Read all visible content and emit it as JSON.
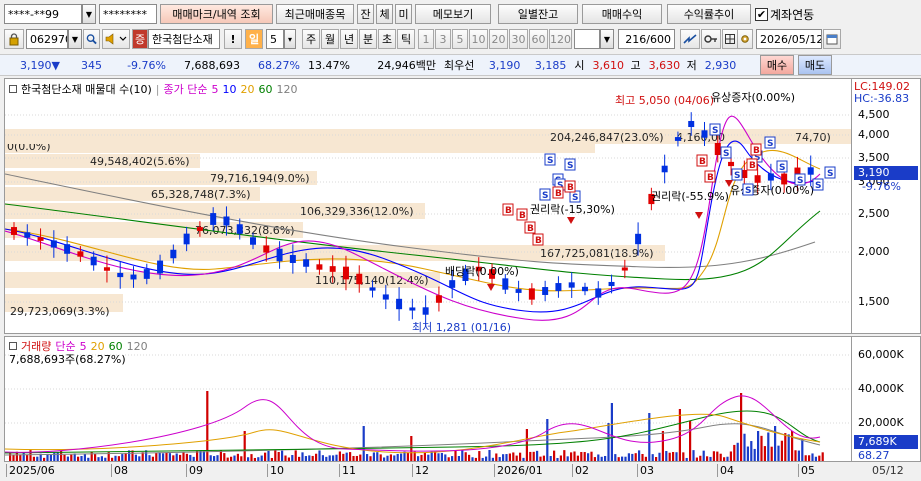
{
  "account": {
    "account_no": "****-**99",
    "password": "********",
    "tabs": [
      "매매마크/내역 조회",
      "최근매매종목",
      "잔",
      "체",
      "미",
      "메모보기"
    ],
    "right_buttons": [
      "일별잔고",
      "매매수익",
      "수익률추이"
    ],
    "link_label": "계좌연동",
    "link_checked": true
  },
  "toolbar": {
    "code": "062970",
    "name": "한국첨단소재",
    "period_selected": "일",
    "period_value": "5",
    "periods": [
      "주",
      "월",
      "년",
      "분",
      "초",
      "틱"
    ],
    "intervals": [
      "1",
      "3",
      "5",
      "10",
      "20",
      "30",
      "60",
      "120"
    ],
    "count": "216",
    "count_total": "/600",
    "date": "2026/05/12",
    "mark_icon": "exclamation-icon"
  },
  "quote": {
    "price": "3,190",
    "change": "345",
    "rate": "-9.76%",
    "volume": "7,688,693",
    "vol_ratio": "68.27%",
    "turnover": "13.47%",
    "amount": "24,946백만",
    "best_bid_label": "최우선",
    "best_ask": "3,190",
    "best_bid": "3,185",
    "open_label": "시",
    "open": "3,610",
    "high_label": "고",
    "high": "3,630",
    "low_label": "저",
    "low": "2,930",
    "buy_label": "매수",
    "sell_label": "매도"
  },
  "price_chart": {
    "title": "한국첨단소재 매물대 수(10)",
    "ma_label": "종가 단순",
    "ma_periods": [
      "5",
      "10",
      "20",
      "60",
      "120"
    ],
    "ma_colors": [
      "#cc00cc",
      "#0000ff",
      "#e0a000",
      "#008000",
      "#808080"
    ],
    "lc": "LC:149.02",
    "hc": "HC:-36.83",
    "current_price": "3,190",
    "current_rate": "-9.76%",
    "high_note": "최고 5,050 (04/06)",
    "low_note": "최저 1,281 (01/16)",
    "annotations": [
      "유상증자(0.00%)",
      "권리락(-15,30%)",
      "권리락(-55.9%)",
      "유상증자(0.00%)",
      "배당락(0.00%)"
    ],
    "volume_profile": [
      {
        "label": "0(0.0%)"
      },
      {
        "label": "49,548,402(5.6%)"
      },
      {
        "label": "79,716,194(9.0%)"
      },
      {
        "label": "65,328,748(7.3%)"
      },
      {
        "label": "106,329,336(12.0%)"
      },
      {
        "label": "76,073,332(8.6%)"
      },
      {
        "label": "110,175,140(12.4%)"
      },
      {
        "label": "167,725,081(18.9%)"
      },
      {
        "label": "29,723,069(3.3%)"
      },
      {
        "label": "204,246,847(23.0%)"
      },
      {
        "label": "4,160,00"
      },
      {
        "label": "74,70)"
      }
    ],
    "axis_ticks": [
      "4,500",
      "4,000",
      "3,500",
      "3,000",
      "2,500",
      "2,000",
      "1,500"
    ]
  },
  "volume_chart": {
    "title": "거래량",
    "ma_label": "단순",
    "ma_periods": [
      "5",
      "20",
      "60",
      "120"
    ],
    "ma_colors": [
      "#cc00cc",
      "#e0a000",
      "#008000",
      "#808080"
    ],
    "subtitle": "7,688,693주(68.27%)",
    "axis_ticks": [
      "60,000K",
      "40,000K",
      "20,000K"
    ],
    "current": "7,689K",
    "current_rate": "68.27"
  },
  "date_axis": [
    "2025/06",
    "08",
    "09",
    "10",
    "11",
    "12",
    "2026/01",
    "02",
    "03",
    "04",
    "05",
    "05/12"
  ]
}
